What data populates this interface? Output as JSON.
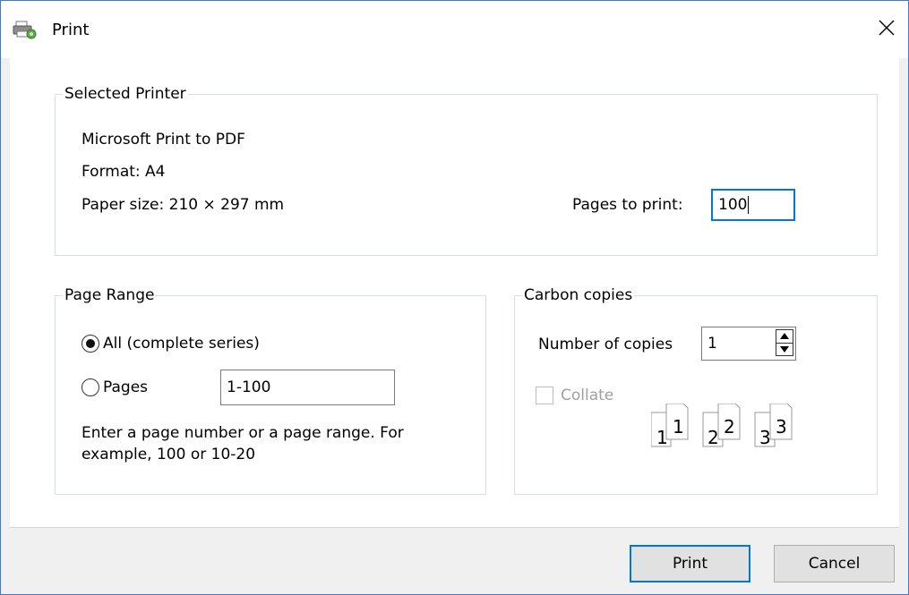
{
  "window": {
    "title": "Print",
    "close_glyph": "✕"
  },
  "selected_printer": {
    "legend": "Selected Printer",
    "printer_name": "Microsoft Print to PDF",
    "format": "Format: A4",
    "paper_size": "Paper size: 210 × 297  mm",
    "pages_to_print_label": "Pages to print:",
    "pages_to_print_value": "100"
  },
  "page_range": {
    "legend": "Page Range",
    "all_label": "All (complete series)",
    "pages_label": "Pages",
    "pages_value": "1-100",
    "hint_line1": "Enter a page number or a page range. For",
    "hint_line2": "example, 100 or 10-20",
    "selected": "all"
  },
  "carbon_copies": {
    "legend": "Carbon copies",
    "copies_label": "Number of copies",
    "copies_value": "1",
    "collate_label": "Collate",
    "collate_checked": false,
    "collate_enabled": false,
    "collate_pages": [
      "1",
      "2",
      "3"
    ]
  },
  "buttons": {
    "print": "Print",
    "cancel": "Cancel"
  },
  "colors": {
    "accent": "#0078d7",
    "window_border": "#3c7bc6"
  },
  "icons": {
    "title": "printer-icon",
    "close": "close-icon"
  }
}
